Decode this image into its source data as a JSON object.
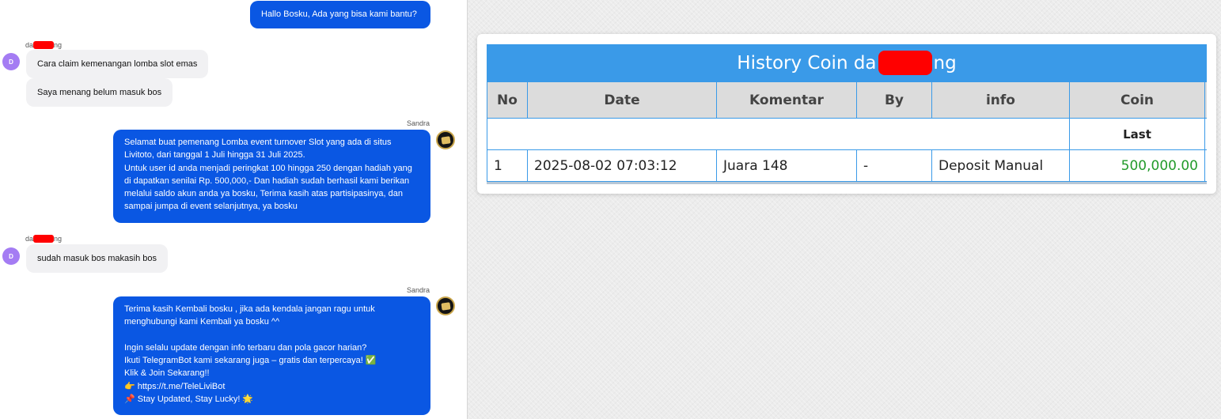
{
  "chat": {
    "messages": [
      {
        "type": "out",
        "text": "Hallo Bosku, Ada yang bisa kami bantu?"
      },
      {
        "type": "in_group",
        "sender_prefix": "da",
        "sender_suffix": "ng",
        "avatar": "D",
        "bubbles": [
          "Cara claim kemenangan lomba slot emas",
          "Saya menang belum masuk bos"
        ]
      },
      {
        "type": "out",
        "sender": "Sandra",
        "text": "Selamat buat pemenang Lomba event turnover Slot yang ada di situs\nLivitoto, dari tanggal 1 Juli hingga 31 Juli 2025.\nUntuk user id anda menjadi peringkat 100 hingga 250 dengan hadiah yang\ndi dapatkan senilai Rp. 500,000,- Dan hadiah sudah berhasil kami berikan\nmelalui saldo akun anda ya bosku, Terima kasih atas partisipasinya, dan\nsampai jumpa di event selanjutnya, ya bosku"
      },
      {
        "type": "in_group",
        "sender_prefix": "da",
        "sender_suffix": "ng",
        "avatar": "D",
        "bubbles": [
          "sudah masuk bos makasih bos"
        ]
      },
      {
        "type": "out",
        "sender": "Sandra",
        "text": "Terima kasih Kembali bosku , jika ada kendala jangan ragu untuk\nmenghubungi kami Kembali ya bosku ^^\n\nIngin selalu update dengan info terbaru dan pola gacor harian?\nIkuti TelegramBot kami sekarang juga – gratis dan terpercaya! ✅\nKlik & Join Sekarang!!\n👉 https://t.me/TeleLiviBot\n📌 Stay Updated, Stay Lucky! 🌟"
      }
    ]
  },
  "history": {
    "title_prefix": "History Coin da",
    "title_suffix": "ng",
    "columns": [
      "No",
      "Date",
      "Komentar",
      "By",
      "info",
      "Coin"
    ],
    "last_label": "Last",
    "rows": [
      {
        "no": "1",
        "date": "2025-08-02 07:03:12",
        "komentar": "Juara 148",
        "by": "-",
        "info": "Deposit Manual",
        "coin": "500,000.00"
      }
    ]
  },
  "colors": {
    "agent_bubble": "#0a57e3",
    "user_bubble": "#f1f1f3",
    "table_header": "#3a9ae8",
    "coin_positive": "#239b2b",
    "redaction": "#ff0000"
  }
}
